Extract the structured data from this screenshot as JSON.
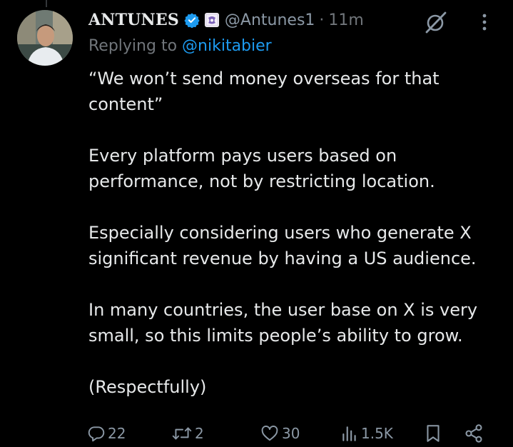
{
  "tweet": {
    "author": {
      "display_name": "ANTUNES",
      "handle": "@Antunes1",
      "avatar_icon": "avatar-photo"
    },
    "separator": "·",
    "timestamp": "11m",
    "replying_prefix": "Replying to ",
    "replying_to": "@nikitabier",
    "paragraphs": [
      "“We won’t send money overseas for that content”",
      "Every platform pays users based on performance, not by restricting location.",
      "Especially considering users who generate X significant revenue by having a US audience.",
      "In many countries, the user base on X is very small, so this limits people’s ability to grow.",
      "(Respectfully)"
    ],
    "actions": {
      "replies": "22",
      "reposts": "2",
      "likes": "30",
      "views": "1.5K"
    }
  },
  "colors": {
    "background": "#000000",
    "text_primary": "#e7e9ea",
    "text_secondary": "#71767b",
    "link": "#1d9bf0",
    "verified_badge": "#1d9bf0"
  },
  "icons": {
    "verified": "verified-check-icon",
    "affiliate": "affiliate-badge-icon",
    "grok": "grok-icon",
    "more": "more-vertical-icon",
    "reply": "reply-icon",
    "repost": "repost-icon",
    "like": "heart-icon",
    "views": "views-chart-icon",
    "bookmark": "bookmark-icon",
    "share": "share-icon"
  }
}
